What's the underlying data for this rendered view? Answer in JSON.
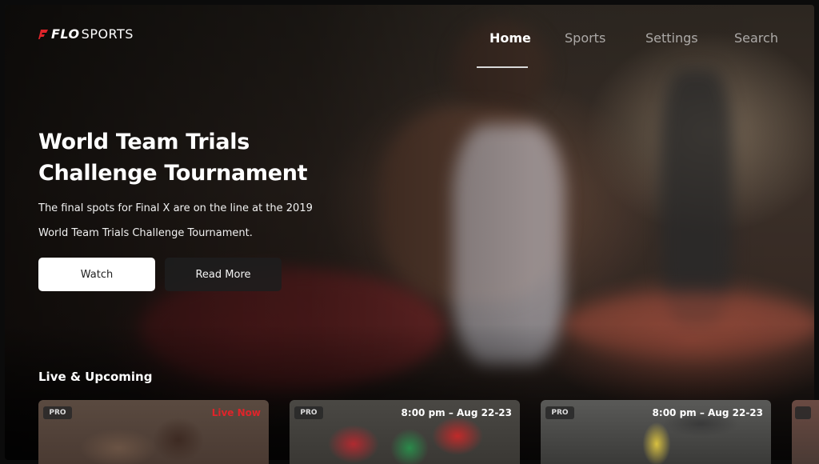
{
  "brand": {
    "logo_flo": "FLO",
    "logo_sports": "SPORTS"
  },
  "nav": {
    "items": [
      {
        "label": "Home",
        "active": true
      },
      {
        "label": "Sports",
        "active": false
      },
      {
        "label": "Settings",
        "active": false
      },
      {
        "label": "Search",
        "active": false
      }
    ]
  },
  "hero": {
    "title_line1": "World Team Trials",
    "title_line2": "Challenge Tournament",
    "desc_line1": "The final spots for Final X are on the line at the 2019",
    "desc_line2": "World Team Trials Challenge Tournament.",
    "watch_label": "Watch",
    "more_label": "Read More"
  },
  "rail": {
    "title": "Live & Upcoming",
    "cards": [
      {
        "badge": "PRO",
        "info": "Live Now",
        "live": true
      },
      {
        "badge": "PRO",
        "info": "8:00 pm – Aug 22-23",
        "live": false
      },
      {
        "badge": "PRO",
        "info": "8:00 pm – Aug 22-23",
        "live": false
      },
      {
        "badge": "PRO",
        "info": "",
        "live": false
      }
    ]
  },
  "colors": {
    "accent_red": "#e0242a",
    "button_light": "#ffffff",
    "button_dark": "#1e1e1e"
  }
}
